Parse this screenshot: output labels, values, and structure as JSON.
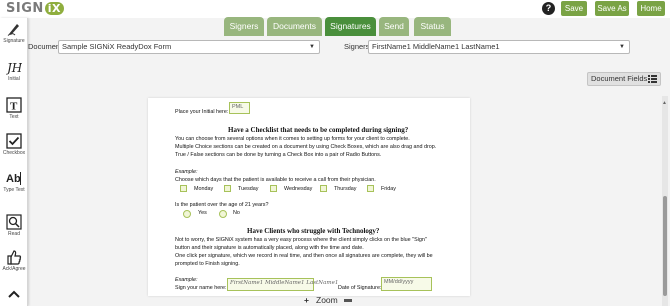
{
  "header": {
    "logo_text": "SIGN",
    "logo_badge": "iX",
    "help_icon": "question-circle-icon",
    "save_label": "Save",
    "save_as_label": "Save As",
    "home_label": "Home"
  },
  "tabs": [
    {
      "label": "Signers",
      "active": false
    },
    {
      "label": "Documents",
      "active": false
    },
    {
      "label": "Signatures",
      "active": true
    },
    {
      "label": "Send",
      "active": false
    },
    {
      "label": "Status",
      "active": false
    }
  ],
  "selectors": {
    "documents_label": "Documents",
    "documents_value": "Sample SIGNiX ReadyDox Form",
    "signers_label": "Signers",
    "signers_value": "FirstName1 MiddleName1 LastName1"
  },
  "tools": [
    {
      "label": "Signature",
      "icon": "pen-icon"
    },
    {
      "label": "Initial",
      "icon": "initials-icon"
    },
    {
      "label": "Text",
      "icon": "text-box-icon"
    },
    {
      "label": "Checkbox",
      "icon": "checkbox-icon"
    },
    {
      "label": "Type Text",
      "icon": "type-text-icon"
    },
    {
      "label": "Read",
      "icon": "magnifier-icon"
    },
    {
      "label": "Ack/Agree",
      "icon": "thumbs-up-icon"
    }
  ],
  "document_fields_label": "Document Fields",
  "page": {
    "initial_prompt": "Place your Initial here:",
    "initial_field": "PML",
    "heading1": "Have a Checklist that needs to be completed during signing?",
    "para1_line1": "You can choose from several options when it comes to setting up forms for your client to complete.",
    "para1_line2": "Multiple Choice sections can be created on a document by using Check Boxes, which are also drag and drop.",
    "para1_line3": "True / False sections can be done by turning a Check Box into a pair of Radio Buttons.",
    "example1": "Example:",
    "days_prompt": "Choose which days that the patient is available to receive a call from their physician.",
    "days": [
      "Monday",
      "Tuesday",
      "Wednesday",
      "Thursday",
      "Friday"
    ],
    "age_prompt": "Is the patient over the age of 21 years?",
    "yes": "Yes",
    "no": "No",
    "heading2": "Have Clients who struggle with Technology?",
    "para2_line1": "Not to worry, the SIGNiX system has a very easy process where the client simply clicks on the blue \"Sign\"",
    "para2_line2": "button and their signature is automatically placed, along with the time and date.",
    "para2_line3": "One click per signature, which we record in real time, and then once all signatures are complete, they will be",
    "para2_line4": "prompted to Finish signing.",
    "example2": "Example:",
    "sign_prompt": "Sign your name here:",
    "sign_field": "FirstName1 MiddleName1 LastName1",
    "date_prompt": "Date of Signature:",
    "date_field": "MM/dd/yyyy"
  },
  "zoom": {
    "label": "Zoom",
    "plus_icon": "plus-icon",
    "minus_icon": "minus-icon"
  }
}
